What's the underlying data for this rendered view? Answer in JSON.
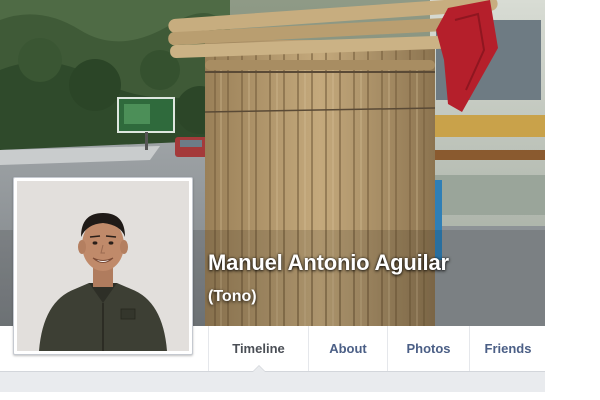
{
  "profile": {
    "name": "Manuel Antonio Aguilar",
    "alternate_name": "(Tono)"
  },
  "nav": {
    "tabs": [
      {
        "label": "Timeline",
        "active": true
      },
      {
        "label": "About",
        "active": false
      },
      {
        "label": "Photos",
        "active": false
      },
      {
        "label": "Friends",
        "active": false
      }
    ]
  },
  "colors": {
    "tab_text": "#4b5f86",
    "active_tab_text": "#4b4f56",
    "nav_divider": "#d3d6db",
    "page_background": "#e9ebee"
  }
}
